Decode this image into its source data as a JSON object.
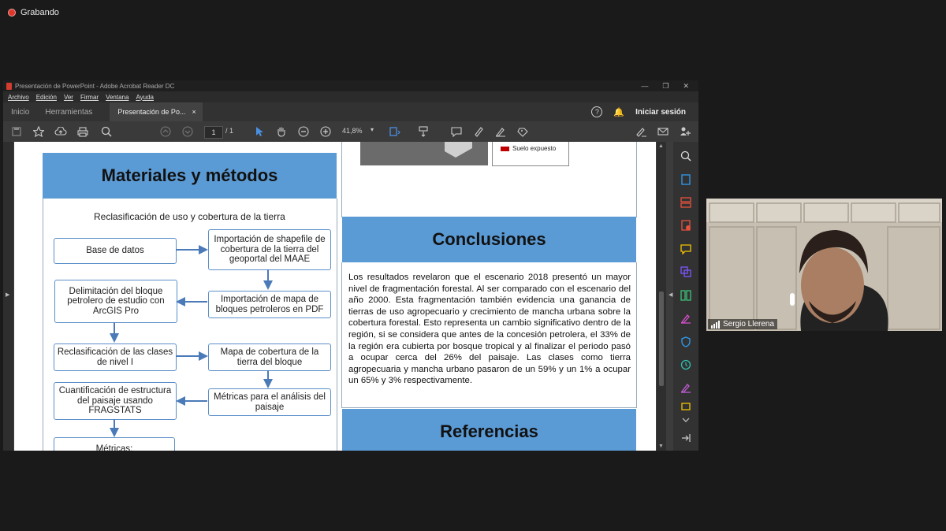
{
  "recording": {
    "label": "Grabando"
  },
  "window": {
    "title": "Presentación de PowerPoint - Adobe Acrobat Reader DC",
    "controls": [
      "—",
      "❐",
      "✕"
    ]
  },
  "menu": [
    "Archivo",
    "Edición",
    "Ver",
    "Firmar",
    "Ventana",
    "Ayuda"
  ],
  "tabs": {
    "home": "Inicio",
    "tools": "Herramientas",
    "doc": "Presentación de Po...",
    "doc_close": "×",
    "help": "?",
    "signin": "Iniciar sesión"
  },
  "toolbar": {
    "page_current": "1",
    "page_total": "/ 1",
    "zoom": "41,8%",
    "zoom_arrow": "▾"
  },
  "poster": {
    "materials_title": "Materiales y métodos",
    "flow_subtitle": "Reclasificación de uso y cobertura de la tierra",
    "flow": {
      "base": "Base de datos",
      "import_shp": "Importación de shapefile de cobertura de la tierra del geoportal del MAAE",
      "delim": "Delimitación del bloque petrolero de estudio con ArcGIS Pro",
      "import_map": "Importación de mapa de bloques petroleros en PDF",
      "reclass": "Reclasificación de las clases de nivel I",
      "cover_map": "Mapa de cobertura de la tierra del bloque",
      "quant": "Cuantificación de estructura del paisaje usando FRAGSTATS",
      "metrics": "Métricas para el análisis del paisaje",
      "metrics2": "Métricas:"
    },
    "legend_item": "Suelo expuesto",
    "conclusions_title": "Conclusiones",
    "conclusions_text": "Los resultados revelaron que el escenario 2018 presentó un mayor nivel de fragmentación forestal. Al ser comparado con el escenario del año 2000. Esta fragmentación también evidencia una ganancia de tierras de uso agropecuario y crecimiento de mancha urbana sobre la cobertura forestal. Esto representa un cambio significativo dentro de la región, si se considera que antes de la concesión petrolera, el 33% de la región era cubierta por bosque tropical y al finalizar el periodo pasó a ocupar cerca del 26% del paisaje. Las clases como tierra agropecuaria y mancha urbano pasaron de un 59% y un 1% a ocupar un 65% y 3% respectivamente.",
    "references_title": "Referencias"
  },
  "participant": {
    "name": "Sergio Llerena"
  },
  "colors": {
    "header_blue": "#5b9bd5",
    "legend_red": "#c00000",
    "rec_red": "#e0362c"
  }
}
